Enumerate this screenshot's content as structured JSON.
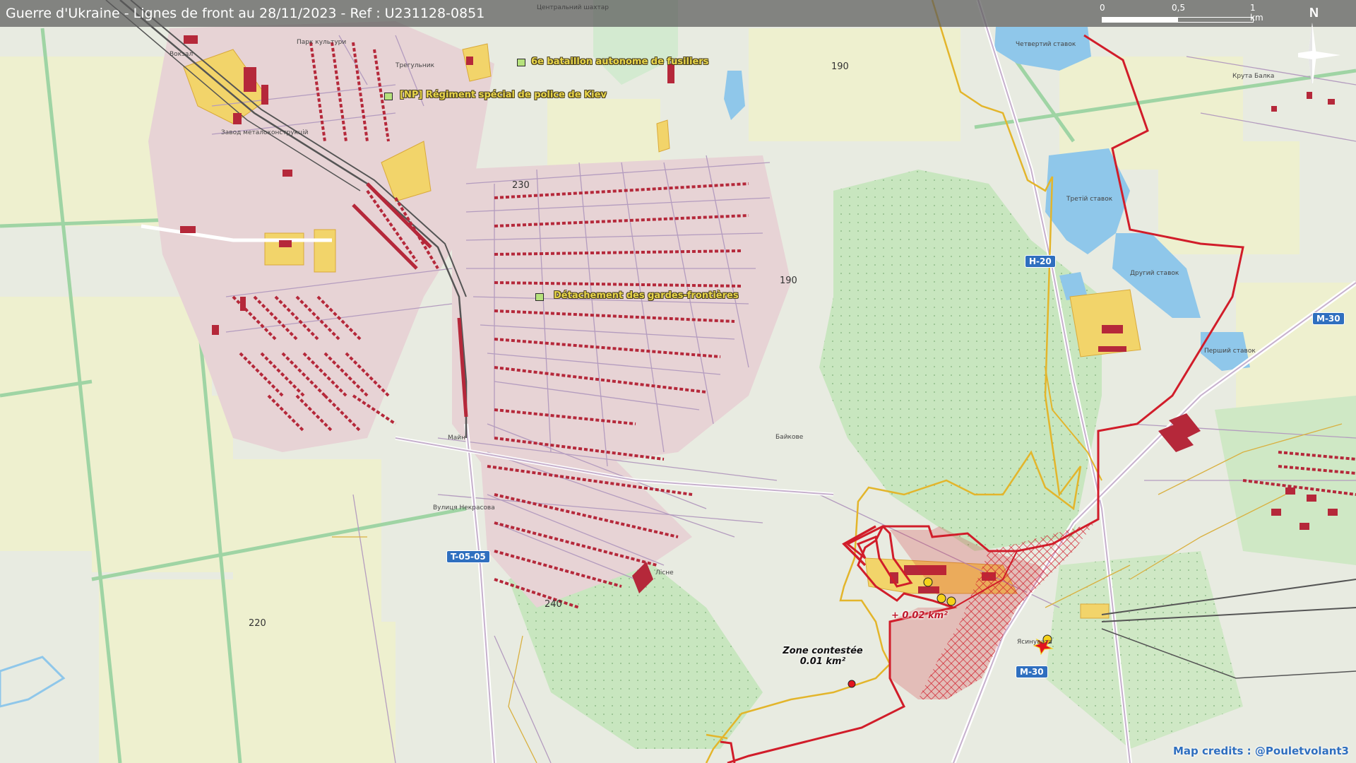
{
  "header": {
    "title": "Guerre d'Ukraine - Lignes de front au 28/11/2023 - Ref : U231128-0851"
  },
  "scale": {
    "labels": [
      "0",
      "0,5",
      "1 km"
    ]
  },
  "compass": {
    "north": "N"
  },
  "units": [
    {
      "name": "6e bataillon autonome de fusiliers"
    },
    {
      "name": "[NP] Régiment spécial de police de Kiev"
    },
    {
      "name": "Détachement des gardes-frontières"
    }
  ],
  "elevations": [
    "190",
    "230",
    "190",
    "240",
    "220"
  ],
  "roads": [
    "H-20",
    "M-30",
    "T-05-05",
    "M-30"
  ],
  "zones": {
    "contested_title": "Zone contestée",
    "contested_area": "0.01 km²",
    "gain": "+ 0.02 km²"
  },
  "places": [
    "Вокзал",
    "Парк культури",
    "Завод металоконструкцій",
    "Трегульник",
    "Центральний шахтар",
    "Четвертий ставок",
    "Третій ставок",
    "Другий ставок",
    "Перший ставок",
    "Крута Балка",
    "Байкове",
    "Ясинувата",
    "Майн",
    "Вулиця Некрасова",
    "Лісне"
  ],
  "credits": "Map credits : @Pouletvolant3",
  "colors": {
    "front_line": "#d11d2a",
    "ukraine_line": "#e3b52b",
    "road_shield": "#2f6fbf",
    "water": "#8fc7ea",
    "forest": "#bfe3b8",
    "fields": "#eef0cf",
    "buildings": "#b5283a"
  }
}
